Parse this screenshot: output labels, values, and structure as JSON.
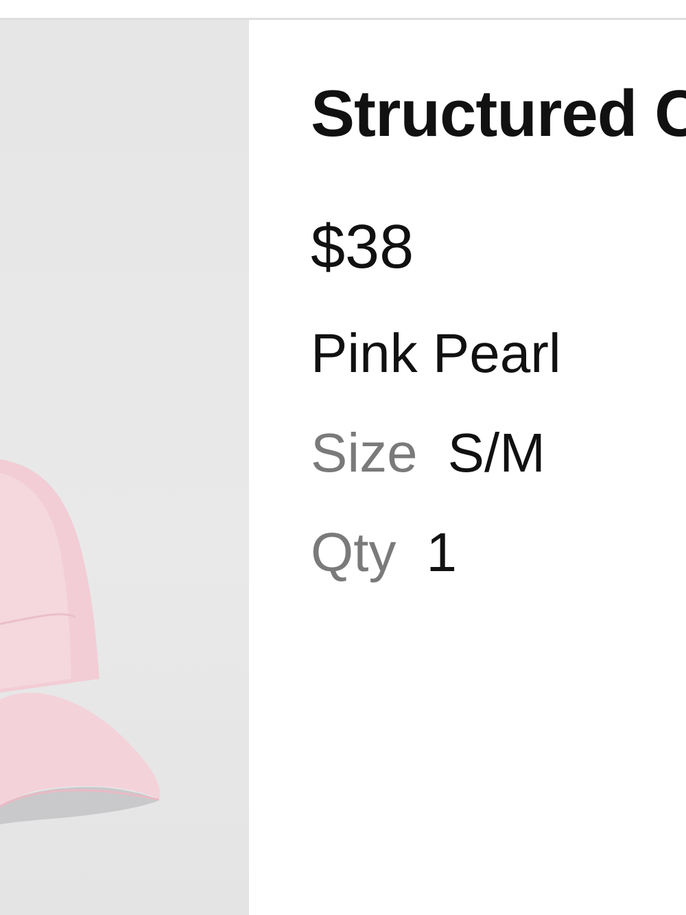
{
  "product": {
    "title": "Structured C",
    "price": "$38",
    "color": "Pink Pearl",
    "size_label": "Size",
    "size_value": "S/M",
    "qty_label": "Qty",
    "qty_value": "1",
    "image_icon": "pink-cap-image"
  },
  "colors": {
    "cap_pink": "#f3d3da",
    "background_gray": "#e7e7e7",
    "label_gray": "#7a7a7a",
    "text_black": "#111111"
  }
}
